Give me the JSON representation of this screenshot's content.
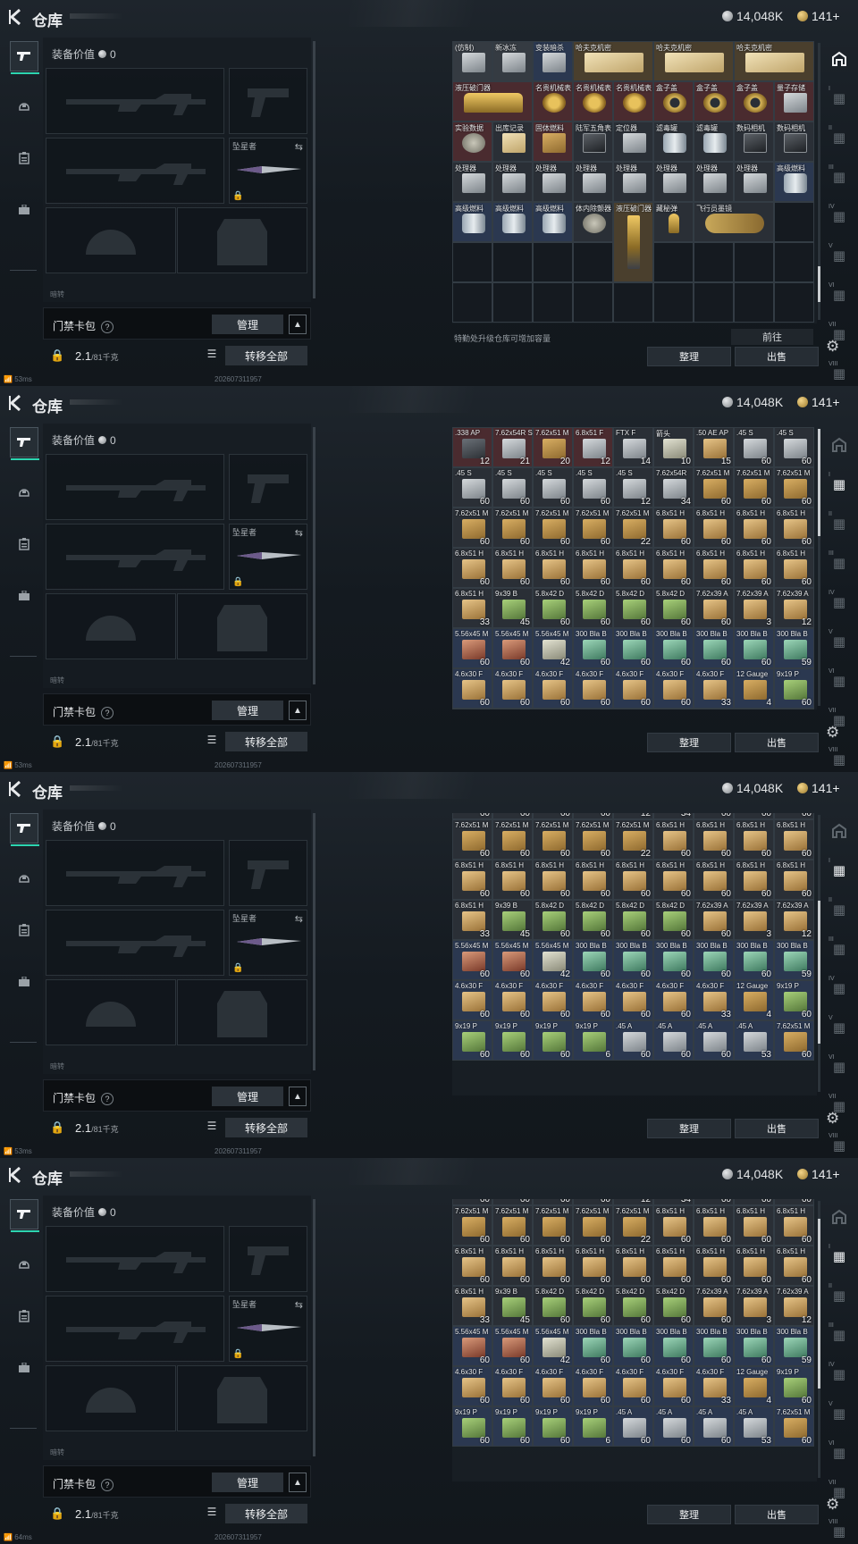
{
  "header": {
    "title": "仓库",
    "silver": "14,048K",
    "gold": "141+"
  },
  "colors": {
    "accent": "#2dd5b0",
    "background": "#161b21",
    "cell_red": "#4a2b2f",
    "cell_blue": "#2b3850",
    "cell_gold": "#4a3f2d"
  },
  "left_tabs": [
    "pistol-icon",
    "helmet-icon",
    "clipboard-icon",
    "briefcase-icon"
  ],
  "equipment": {
    "value_label": "装备价值",
    "value": "0",
    "knife_slot_label": "坠星者",
    "bottom_caption": "暗转",
    "keycard_label": "门禁卡包",
    "help": "?",
    "manage": "管理",
    "collapse": "^",
    "weight_value": "2.1",
    "weight_max": "/81千克",
    "transfer_all": "转移全部"
  },
  "status": {
    "ping1": "53ms",
    "ping2": "53ms",
    "ping3": "53ms",
    "ping4": "64ms",
    "build": "202607311957"
  },
  "stash_footer": {
    "capacity_note": "特勤处升级仓库可增加容量",
    "goto": "前往",
    "sort": "整理",
    "sell": "出售"
  },
  "right_tabs": [
    "storage-icon",
    "I",
    "II",
    "III",
    "IV",
    "V",
    "VI",
    "VII",
    "VIII"
  ],
  "screen1_items": [
    {
      "lbl": "(仿制)",
      "cls": "gray",
      "ic": "steel",
      "col": 0,
      "row": 0
    },
    {
      "lbl": "新冰冻",
      "cls": "gray",
      "ic": "steel",
      "col": 1,
      "row": 0
    },
    {
      "lbl": "变装暗杀",
      "cls": "blue",
      "ic": "steel",
      "col": 2,
      "row": 0
    },
    {
      "lbl": "哈夫克机密",
      "cls": "gold",
      "ic": "doc",
      "col": 3,
      "row": 0,
      "w": 2
    },
    {
      "lbl": "哈夫克机密",
      "cls": "gold",
      "ic": "doc",
      "col": 5,
      "row": 0,
      "w": 2
    },
    {
      "lbl": "哈夫克机密",
      "cls": "gold",
      "ic": "doc",
      "col": 7,
      "row": 0,
      "w": 2
    },
    {
      "lbl": "液压破门器",
      "cls": "red",
      "ic": "bullet",
      "col": 0,
      "row": 1,
      "w": 2
    },
    {
      "lbl": "名贵机械表",
      "cls": "red",
      "ic": "watch",
      "col": 2,
      "row": 1
    },
    {
      "lbl": "名贵机械表",
      "cls": "red",
      "ic": "watch",
      "col": 3,
      "row": 1
    },
    {
      "lbl": "名贵机械表",
      "cls": "red",
      "ic": "watch",
      "col": 4,
      "row": 1
    },
    {
      "lbl": "盒子盖",
      "cls": "red",
      "ic": "ring",
      "col": 5,
      "row": 1
    },
    {
      "lbl": "盒子盖",
      "cls": "red",
      "ic": "ring",
      "col": 6,
      "row": 1
    },
    {
      "lbl": "盒子盖",
      "cls": "red",
      "ic": "ring",
      "col": 7,
      "row": 1
    },
    {
      "lbl": "量子存储",
      "cls": "red",
      "ic": "steel",
      "col": 8,
      "row": 1
    },
    {
      "lbl": "实验数据",
      "cls": "red",
      "ic": "dish",
      "col": 0,
      "row": 2
    },
    {
      "lbl": "出库记录",
      "cls": "itm",
      "ic": "doc",
      "col": 1,
      "row": 2
    },
    {
      "lbl": "固体燃料",
      "cls": "red",
      "ic": "box",
      "col": 2,
      "row": 2
    },
    {
      "lbl": "陆军五角表",
      "cls": "itm",
      "ic": "cam",
      "col": 3,
      "row": 2
    },
    {
      "lbl": "定位器",
      "cls": "itm",
      "ic": "steel",
      "col": 4,
      "row": 2
    },
    {
      "lbl": "滤毒罐",
      "cls": "itm",
      "ic": "can",
      "col": 5,
      "row": 2
    },
    {
      "lbl": "滤毒罐",
      "cls": "itm",
      "ic": "can",
      "col": 6,
      "row": 2
    },
    {
      "lbl": "数码相机",
      "cls": "itm",
      "ic": "cam",
      "col": 7,
      "row": 2
    },
    {
      "lbl": "数码相机",
      "cls": "itm",
      "ic": "cam",
      "col": 8,
      "row": 2
    },
    {
      "lbl": "处理器",
      "cls": "itm",
      "ic": "steel",
      "col": 0,
      "row": 3
    },
    {
      "lbl": "处理器",
      "cls": "itm",
      "ic": "steel",
      "col": 1,
      "row": 3
    },
    {
      "lbl": "处理器",
      "cls": "itm",
      "ic": "steel",
      "col": 2,
      "row": 3
    },
    {
      "lbl": "处理器",
      "cls": "itm",
      "ic": "steel",
      "col": 3,
      "row": 3
    },
    {
      "lbl": "处理器",
      "cls": "itm",
      "ic": "steel",
      "col": 4,
      "row": 3
    },
    {
      "lbl": "处理器",
      "cls": "itm",
      "ic": "steel",
      "col": 5,
      "row": 3
    },
    {
      "lbl": "处理器",
      "cls": "itm",
      "ic": "steel",
      "col": 6,
      "row": 3
    },
    {
      "lbl": "处理器",
      "cls": "itm",
      "ic": "steel",
      "col": 7,
      "row": 3
    },
    {
      "lbl": "高级燃料",
      "cls": "blue",
      "ic": "can",
      "col": 8,
      "row": 3
    },
    {
      "lbl": "高级燃料",
      "cls": "blue",
      "ic": "can",
      "col": 0,
      "row": 4
    },
    {
      "lbl": "高级燃料",
      "cls": "blue",
      "ic": "can",
      "col": 1,
      "row": 4
    },
    {
      "lbl": "高级燃料",
      "cls": "blue",
      "ic": "can",
      "col": 2,
      "row": 4
    },
    {
      "lbl": "体内除颤器",
      "cls": "itm",
      "ic": "dish",
      "col": 3,
      "row": 4
    },
    {
      "lbl": "液压破门器",
      "cls": "gold",
      "ic": "tall",
      "col": 4,
      "row": 4,
      "h": 2
    },
    {
      "lbl": "藏秘弹",
      "cls": "itm",
      "ic": "bullet",
      "col": 5,
      "row": 4
    },
    {
      "lbl": "飞行员墨镜",
      "cls": "itm",
      "ic": "glasses",
      "col": 6,
      "row": 4,
      "w": 2
    }
  ],
  "ammo_rows": [
    [
      {
        "l": ".338 AP",
        "c": "12",
        "s": "dark",
        "k": "red"
      },
      {
        "l": "7.62x54R S",
        "c": "21",
        "s": "steel",
        "k": "red"
      },
      {
        "l": "7.62x51 M",
        "c": "20",
        "s": "box",
        "k": "red"
      },
      {
        "l": "6.8x51 F",
        "c": "12",
        "s": "steel",
        "k": "red"
      },
      {
        "l": "FTX F",
        "c": "14",
        "s": "steel",
        "k": "itm"
      },
      {
        "l": "箭头",
        "c": "10",
        "s": "ammo-pale",
        "k": "itm"
      },
      {
        "l": ".50 AE AP",
        "c": "15",
        "s": "ammo-tan",
        "k": "itm"
      },
      {
        "l": ".45 S",
        "c": "60",
        "s": "steel",
        "k": "itm"
      },
      {
        "l": ".45 S",
        "c": "60",
        "s": "steel",
        "k": "itm"
      }
    ],
    [
      {
        "l": ".45 S",
        "c": "60",
        "s": "steel",
        "k": "itm"
      },
      {
        "l": ".45 S",
        "c": "60",
        "s": "steel",
        "k": "itm"
      },
      {
        "l": ".45 S",
        "c": "60",
        "s": "steel",
        "k": "itm"
      },
      {
        "l": ".45 S",
        "c": "60",
        "s": "steel",
        "k": "itm"
      },
      {
        "l": ".45 S",
        "c": "12",
        "s": "steel",
        "k": "itm"
      },
      {
        "l": "7.62x54R",
        "c": "34",
        "s": "steel",
        "k": "itm"
      },
      {
        "l": "7.62x51 M",
        "c": "60",
        "s": "box",
        "k": "itm"
      },
      {
        "l": "7.62x51 M",
        "c": "60",
        "s": "box",
        "k": "itm"
      },
      {
        "l": "7.62x51 M",
        "c": "60",
        "s": "box",
        "k": "itm"
      }
    ],
    [
      {
        "l": "7.62x51 M",
        "c": "60",
        "s": "box",
        "k": "itm"
      },
      {
        "l": "7.62x51 M",
        "c": "60",
        "s": "box",
        "k": "itm"
      },
      {
        "l": "7.62x51 M",
        "c": "60",
        "s": "box",
        "k": "itm"
      },
      {
        "l": "7.62x51 M",
        "c": "60",
        "s": "box",
        "k": "itm"
      },
      {
        "l": "7.62x51 M",
        "c": "22",
        "s": "box",
        "k": "itm"
      },
      {
        "l": "6.8x51 H",
        "c": "60",
        "s": "ammo-tan",
        "k": "itm"
      },
      {
        "l": "6.8x51 H",
        "c": "60",
        "s": "ammo-tan",
        "k": "itm"
      },
      {
        "l": "6.8x51 H",
        "c": "60",
        "s": "ammo-tan",
        "k": "itm"
      },
      {
        "l": "6.8x51 H",
        "c": "60",
        "s": "ammo-tan",
        "k": "itm"
      }
    ],
    [
      {
        "l": "6.8x51 H",
        "c": "60",
        "s": "ammo-tan",
        "k": "itm"
      },
      {
        "l": "6.8x51 H",
        "c": "60",
        "s": "ammo-tan",
        "k": "itm"
      },
      {
        "l": "6.8x51 H",
        "c": "60",
        "s": "ammo-tan",
        "k": "itm"
      },
      {
        "l": "6.8x51 H",
        "c": "60",
        "s": "ammo-tan",
        "k": "itm"
      },
      {
        "l": "6.8x51 H",
        "c": "60",
        "s": "ammo-tan",
        "k": "itm"
      },
      {
        "l": "6.8x51 H",
        "c": "60",
        "s": "ammo-tan",
        "k": "itm"
      },
      {
        "l": "6.8x51 H",
        "c": "60",
        "s": "ammo-tan",
        "k": "itm"
      },
      {
        "l": "6.8x51 H",
        "c": "60",
        "s": "ammo-tan",
        "k": "itm"
      },
      {
        "l": "6.8x51 H",
        "c": "60",
        "s": "ammo-tan",
        "k": "itm"
      }
    ],
    [
      {
        "l": "6.8x51 H",
        "c": "33",
        "s": "ammo-tan",
        "k": "itm"
      },
      {
        "l": "9x39 B",
        "c": "45",
        "s": "greenbox",
        "k": "itm"
      },
      {
        "l": "5.8x42 D",
        "c": "60",
        "s": "greenbox",
        "k": "itm"
      },
      {
        "l": "5.8x42 D",
        "c": "60",
        "s": "greenbox",
        "k": "itm"
      },
      {
        "l": "5.8x42 D",
        "c": "60",
        "s": "greenbox",
        "k": "itm"
      },
      {
        "l": "5.8x42 D",
        "c": "60",
        "s": "greenbox",
        "k": "itm"
      },
      {
        "l": "7.62x39 A",
        "c": "60",
        "s": "ammo-tan",
        "k": "itm"
      },
      {
        "l": "7.62x39 A",
        "c": "3",
        "s": "ammo-tan",
        "k": "itm"
      },
      {
        "l": "7.62x39 A",
        "c": "12",
        "s": "ammo-tan",
        "k": "itm"
      }
    ],
    [
      {
        "l": "5.56x45 M",
        "c": "60",
        "s": "ammo-red",
        "k": "blue"
      },
      {
        "l": "5.56x45 M",
        "c": "60",
        "s": "ammo-red",
        "k": "blue"
      },
      {
        "l": "5.56x45 M",
        "c": "42",
        "s": "ammo-pale",
        "k": "blue"
      },
      {
        "l": "300 Bla B",
        "c": "60",
        "s": "ammo-teal",
        "k": "blue"
      },
      {
        "l": "300 Bla B",
        "c": "60",
        "s": "ammo-teal",
        "k": "blue"
      },
      {
        "l": "300 Bla B",
        "c": "60",
        "s": "ammo-teal",
        "k": "blue"
      },
      {
        "l": "300 Bla B",
        "c": "60",
        "s": "ammo-teal",
        "k": "blue"
      },
      {
        "l": "300 Bla B",
        "c": "60",
        "s": "ammo-teal",
        "k": "blue"
      },
      {
        "l": "300 Bla B",
        "c": "59",
        "s": "ammo-teal",
        "k": "blue"
      }
    ],
    [
      {
        "l": "4.6x30 F",
        "c": "60",
        "s": "ammo-tan",
        "k": "blue"
      },
      {
        "l": "4.6x30 F",
        "c": "60",
        "s": "ammo-tan",
        "k": "blue"
      },
      {
        "l": "4.6x30 F",
        "c": "60",
        "s": "ammo-tan",
        "k": "blue"
      },
      {
        "l": "4.6x30 F",
        "c": "60",
        "s": "ammo-tan",
        "k": "blue"
      },
      {
        "l": "4.6x30 F",
        "c": "60",
        "s": "ammo-tan",
        "k": "blue"
      },
      {
        "l": "4.6x30 F",
        "c": "60",
        "s": "ammo-tan",
        "k": "blue"
      },
      {
        "l": "4.6x30 F",
        "c": "33",
        "s": "ammo-tan",
        "k": "blue"
      },
      {
        "l": "12 Gauge",
        "c": "4",
        "s": "box",
        "k": "blue"
      },
      {
        "l": "9x19 P",
        "c": "60",
        "s": "greenbox",
        "k": "blue"
      }
    ],
    [
      {
        "l": "9x19 P",
        "c": "60",
        "s": "greenbox",
        "k": "blue"
      },
      {
        "l": "9x19 P",
        "c": "60",
        "s": "greenbox",
        "k": "blue"
      },
      {
        "l": "9x19 P",
        "c": "60",
        "s": "greenbox",
        "k": "blue"
      },
      {
        "l": "9x19 P",
        "c": "6",
        "s": "greenbox",
        "k": "blue"
      },
      {
        "l": ".45 A",
        "c": "60",
        "s": "steel",
        "k": "blue"
      },
      {
        "l": ".45 A",
        "c": "60",
        "s": "steel",
        "k": "blue"
      },
      {
        "l": ".45 A",
        "c": "60",
        "s": "steel",
        "k": "blue"
      },
      {
        "l": ".45 A",
        "c": "53",
        "s": "steel",
        "k": "blue"
      },
      {
        "l": "7.62x51 M",
        "c": "60",
        "s": "box",
        "k": "blue"
      }
    ]
  ],
  "top_partial_counts": [
    "60",
    "60",
    "60",
    "60",
    "12",
    "34",
    "60",
    "60",
    "60"
  ]
}
